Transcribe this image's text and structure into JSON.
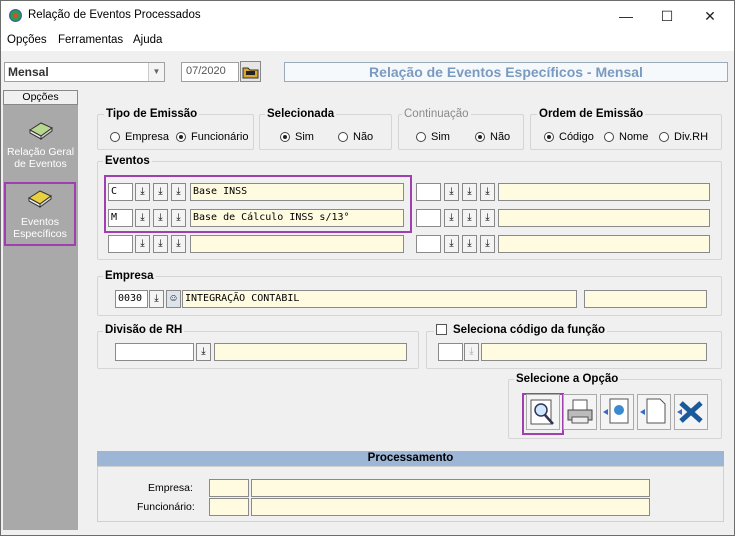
{
  "window": {
    "title": "Relação de Eventos Processados",
    "controls": {
      "minimize": "—",
      "maximize": "☐",
      "close": "✕"
    }
  },
  "menu": [
    "Opções",
    "Ferramentas",
    "Ajuda"
  ],
  "toolbar": {
    "mode_value": "Mensal",
    "period_value": "07/2020",
    "header_title": "Relação de Eventos Específicos - Mensal"
  },
  "sidebar": {
    "header": "Opções",
    "items": [
      {
        "label1": "Relação Geral",
        "label2": "de Eventos"
      },
      {
        "label1": "Eventos",
        "label2": "Específicos"
      }
    ]
  },
  "tipo_emissao": {
    "title": "Tipo de Emissão",
    "options": [
      "Empresa",
      "Funcionário"
    ],
    "selected": "Funcionário"
  },
  "selecionada": {
    "title": "Selecionada",
    "options": [
      "Sim",
      "Não"
    ],
    "selected": "Sim"
  },
  "continuacao": {
    "title": "Continuação",
    "options": [
      "Sim",
      "Não"
    ],
    "selected": "Não"
  },
  "ordem_emissao": {
    "title": "Ordem de Emissão",
    "options": [
      "Código",
      "Nome",
      "Div.RH"
    ],
    "selected": "Código"
  },
  "eventos": {
    "title": "Eventos",
    "left": [
      {
        "code": "C",
        "name": "Base INSS"
      },
      {
        "code": "M",
        "name": "Base de Cálculo INSS s/13°"
      },
      {
        "code": "",
        "name": ""
      }
    ],
    "right": [
      {
        "code": "",
        "name": ""
      },
      {
        "code": "",
        "name": ""
      },
      {
        "code": "",
        "name": ""
      }
    ]
  },
  "empresa": {
    "title": "Empresa",
    "code": "0030",
    "name": "INTEGRAÇÃO CONTABIL",
    "extra": ""
  },
  "divisao_rh": {
    "title": "Divisão de RH",
    "code": "",
    "name": ""
  },
  "funcao": {
    "title": "Seleciona código da função",
    "checked": false,
    "code": "",
    "name": ""
  },
  "selecione_opcao": {
    "title": "Selecione a Opção",
    "buttons": [
      "preview-icon",
      "printer-icon",
      "export-icon",
      "document-icon",
      "excel-icon"
    ]
  },
  "processamento": {
    "title": "Processamento",
    "empresa_label": "Empresa:",
    "funcionario_label": "Funcionário:"
  },
  "colors": {
    "highlight": "#a040b0",
    "header_text": "#7a9ac0",
    "proc_bar": "#9eb6d6",
    "sidebar_bg": "#a9a9a9"
  }
}
